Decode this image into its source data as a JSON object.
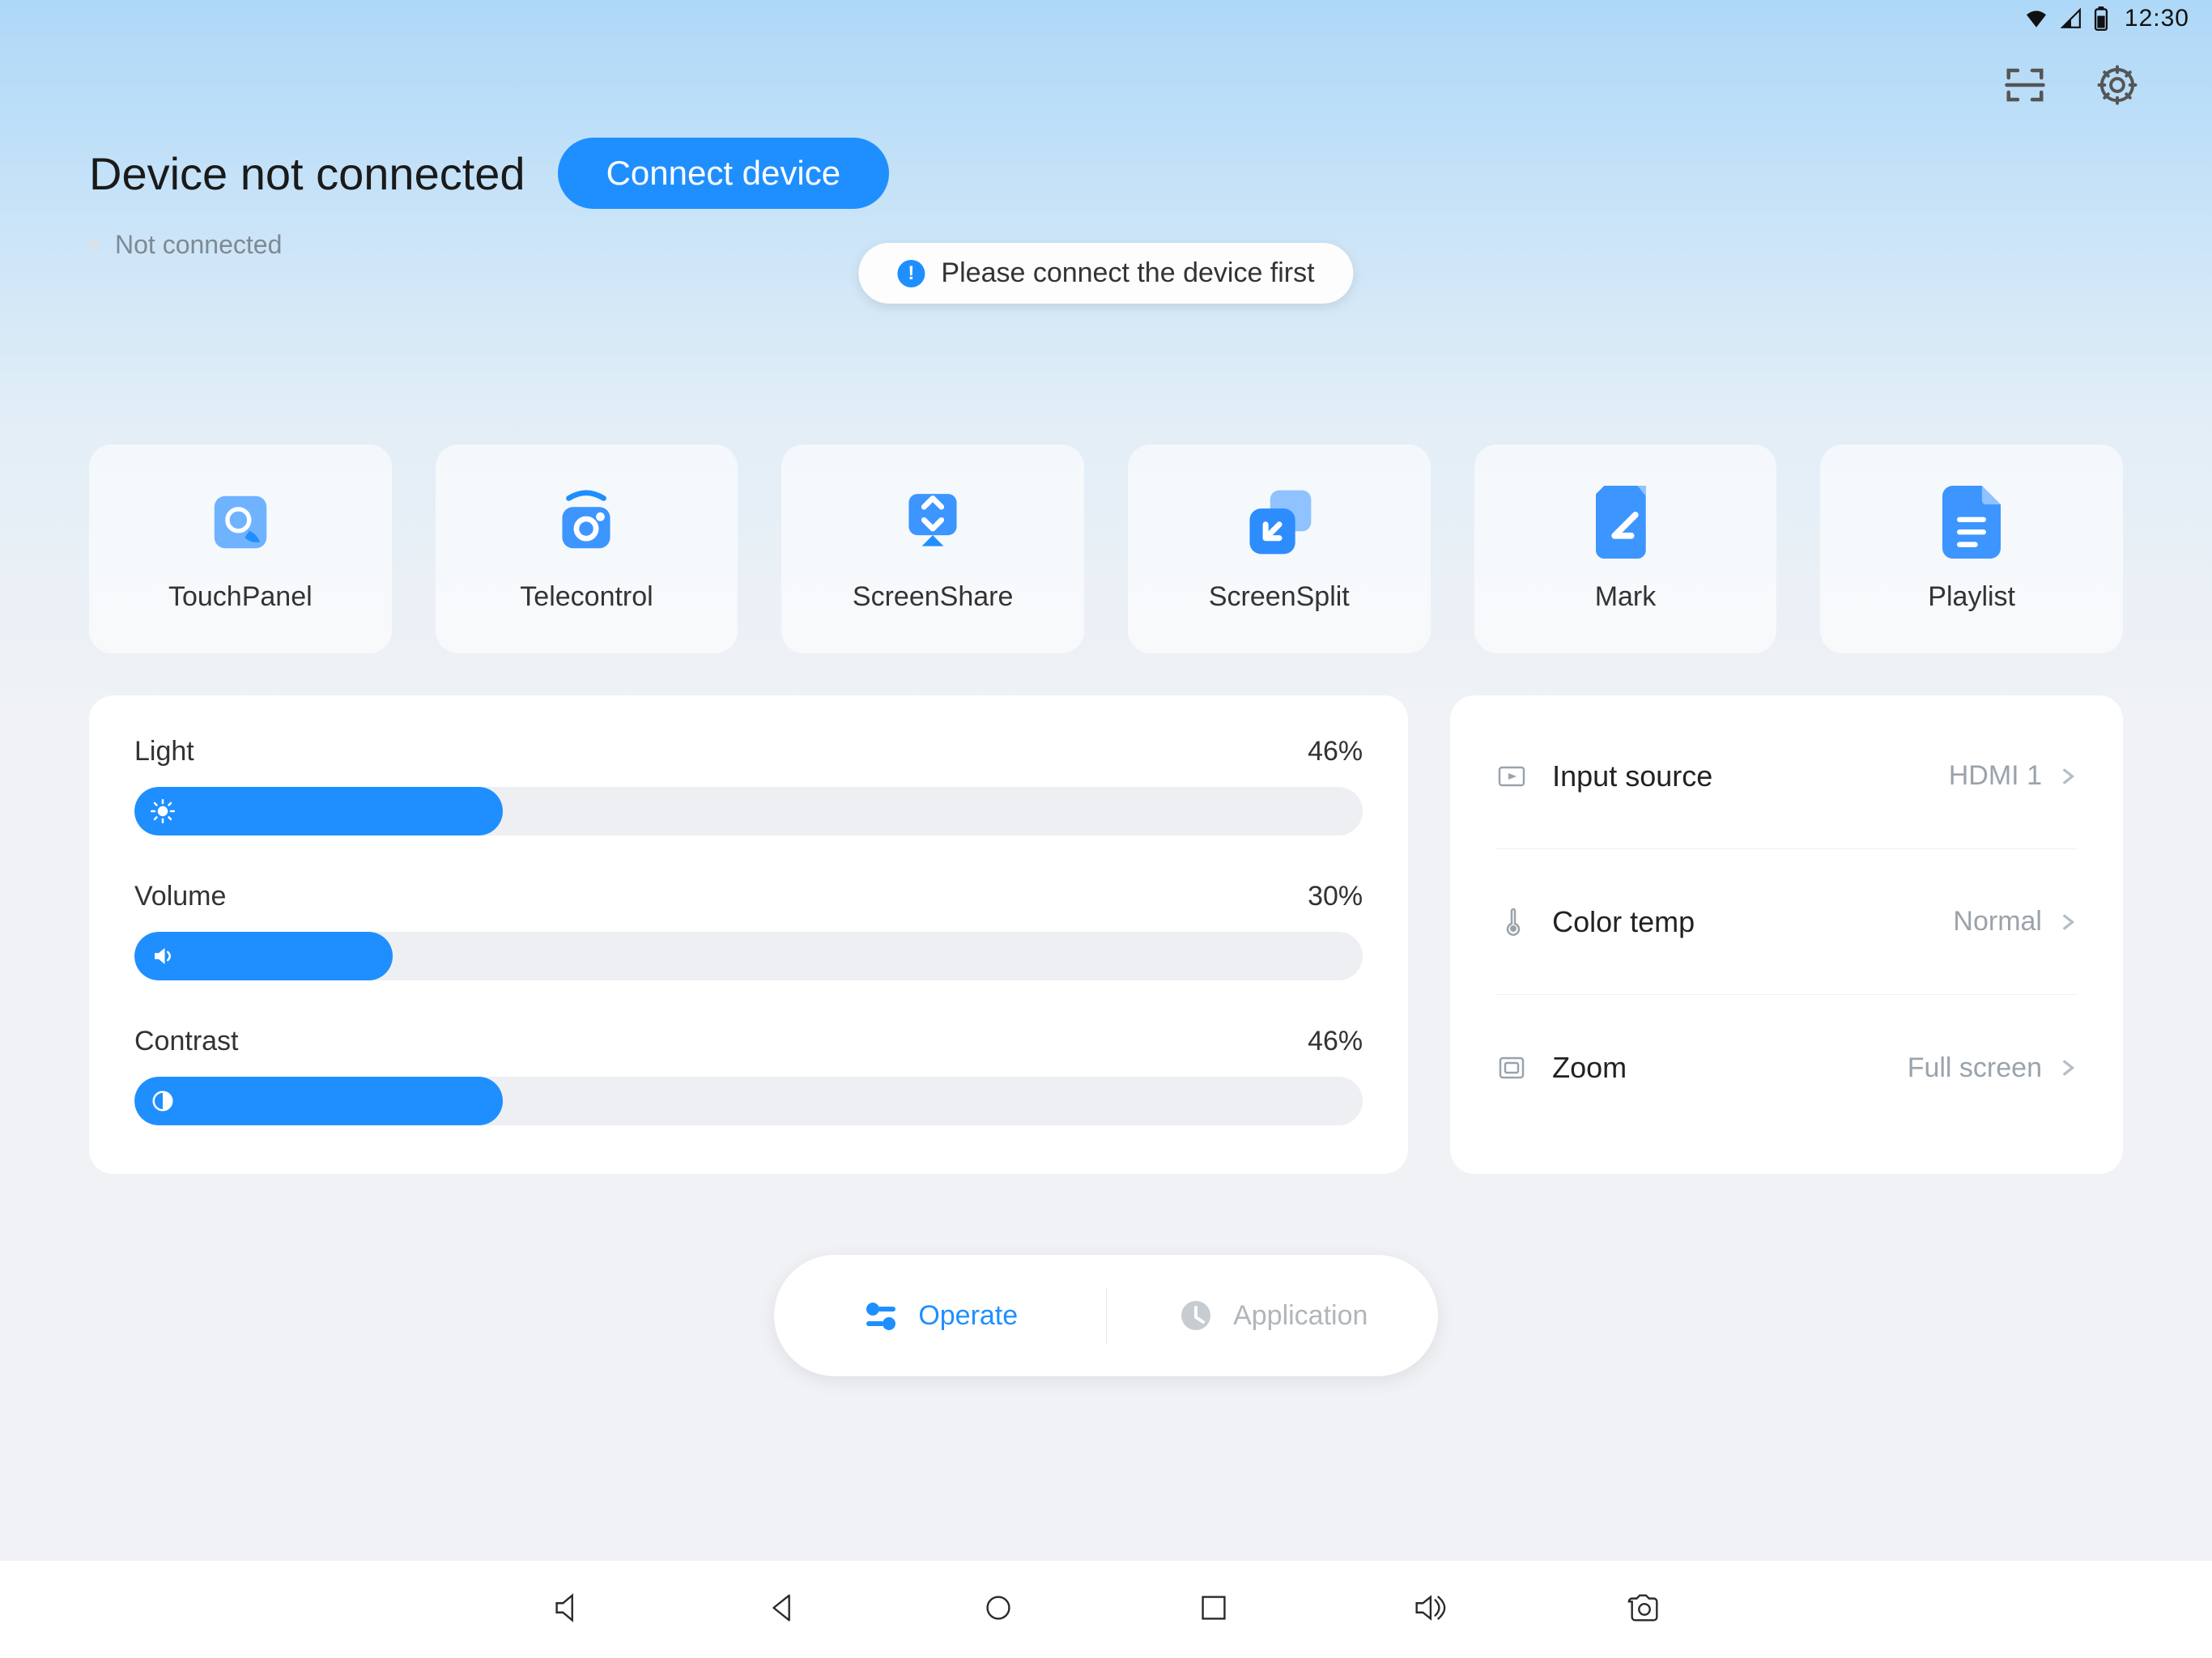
{
  "status_bar": {
    "time": "12:30"
  },
  "header": {
    "title": "Device not connected",
    "connect_button": "Connect device",
    "sub_status": "Not connected",
    "toast": "Please connect the device first"
  },
  "tiles": [
    {
      "label": "TouchPanel"
    },
    {
      "label": "Telecontrol"
    },
    {
      "label": "ScreenShare"
    },
    {
      "label": "ScreenSplit"
    },
    {
      "label": "Mark"
    },
    {
      "label": "Playlist"
    }
  ],
  "sliders": {
    "light": {
      "label": "Light",
      "value": "46%",
      "pct": 30
    },
    "volume": {
      "label": "Volume",
      "value": "30%",
      "pct": 21
    },
    "contrast": {
      "label": "Contrast",
      "value": "46%",
      "pct": 30
    }
  },
  "settings": {
    "input_source": {
      "label": "Input source",
      "value": "HDMI 1"
    },
    "color_temp": {
      "label": "Color temp",
      "value": "Normal"
    },
    "zoom": {
      "label": "Zoom",
      "value": "Full screen"
    }
  },
  "tabs": {
    "operate": "Operate",
    "application": "Application"
  }
}
